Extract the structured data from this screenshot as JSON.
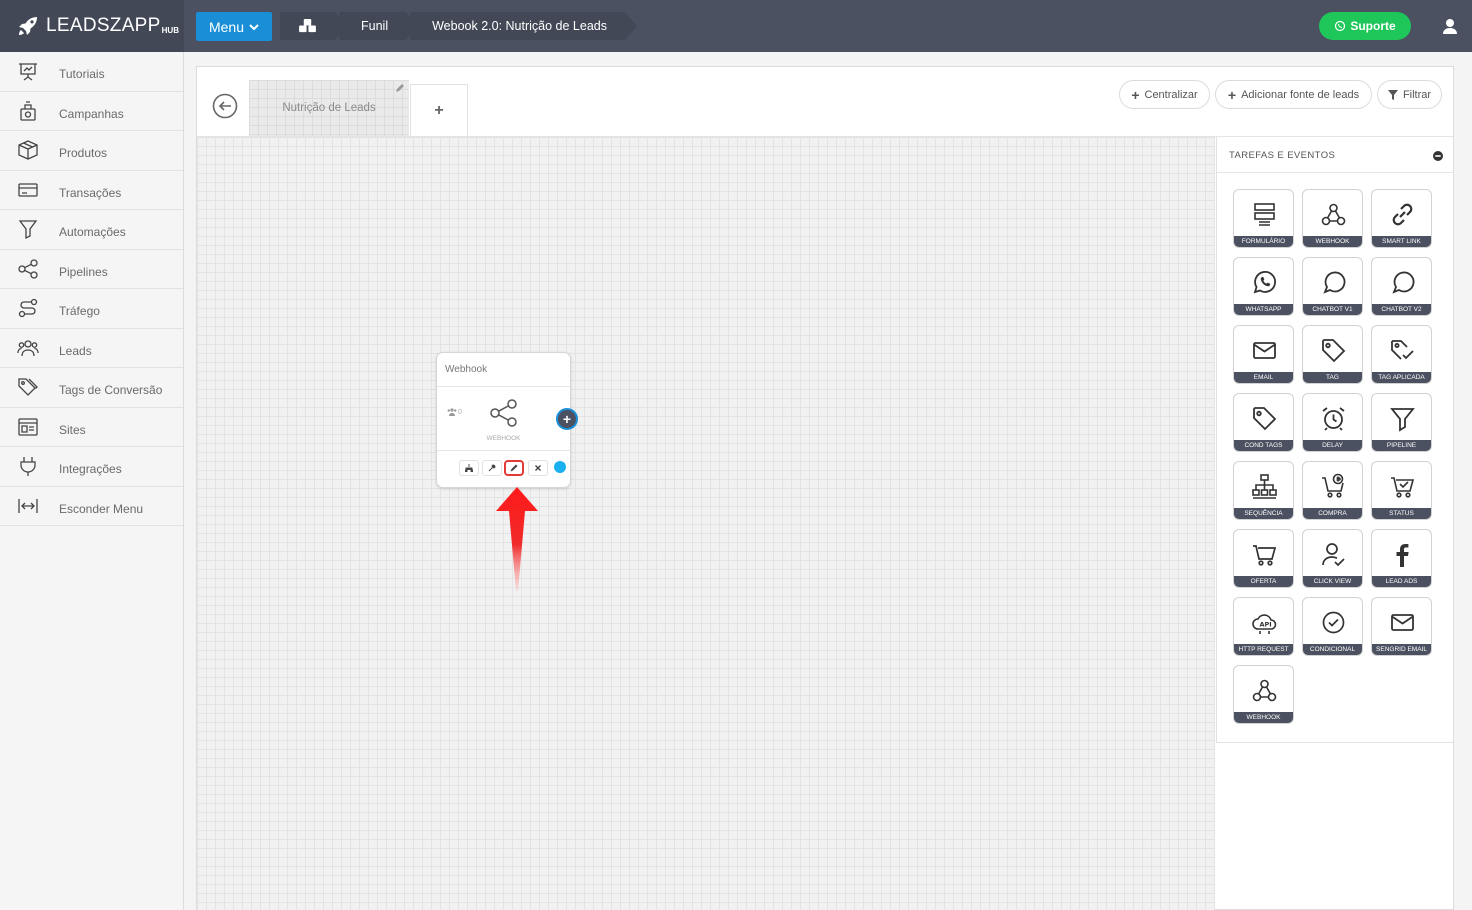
{
  "brand": {
    "name": "LEADSZAPP",
    "suffix": "HUB"
  },
  "header": {
    "menu_label": "Menu",
    "breadcrumbs": [
      "Funil",
      "Webook 2.0: Nutrição de Leads"
    ],
    "support_label": "Suporte",
    "colors": {
      "topbar": "#4b5160",
      "menu": "#1a8fd8",
      "support": "#1fc65a"
    }
  },
  "sidebar": {
    "items": [
      {
        "label": "Tutoriais",
        "icon": "presentation-icon"
      },
      {
        "label": "Campanhas",
        "icon": "campaign-icon"
      },
      {
        "label": "Produtos",
        "icon": "box-icon"
      },
      {
        "label": "Transações",
        "icon": "credit-card-icon"
      },
      {
        "label": "Automações",
        "icon": "funnel-icon"
      },
      {
        "label": "Pipelines",
        "icon": "share-icon"
      },
      {
        "label": "Tráfego",
        "icon": "route-icon"
      },
      {
        "label": "Leads",
        "icon": "users-icon"
      },
      {
        "label": "Tags de Conversão",
        "icon": "tags-icon"
      },
      {
        "label": "Sites",
        "icon": "website-icon"
      },
      {
        "label": "Integrações",
        "icon": "plug-icon"
      },
      {
        "label": "Esconder Menu",
        "icon": "collapse-arrows-icon"
      }
    ]
  },
  "funnel": {
    "active_tab": "Nutrição de Leads",
    "add_tab": "+",
    "actions": {
      "center": "Centralizar",
      "add_source": "Adicionar fonte de leads",
      "filter": "Filtrar"
    }
  },
  "node": {
    "title": "Webhook",
    "count": "0",
    "type_label": "WEBHOOK",
    "plus": "+",
    "status_color": "#1ab0f0"
  },
  "tasks": {
    "title": "TAREFAS E EVENTOS",
    "items": [
      {
        "label": "FORMULÁRIO",
        "icon": "form-icon"
      },
      {
        "label": "WEBHOOK",
        "icon": "webhook-icon"
      },
      {
        "label": "SMART LINK",
        "icon": "link-icon"
      },
      {
        "label": "WHATSAPP",
        "icon": "whatsapp-icon"
      },
      {
        "label": "CHATBOT V1",
        "icon": "chat-bubble-icon"
      },
      {
        "label": "CHATBOT V2",
        "icon": "chat-bubble-icon"
      },
      {
        "label": "EMAIL",
        "icon": "envelope-icon"
      },
      {
        "label": "TAG",
        "icon": "tag-icon"
      },
      {
        "label": "TAG APLICADA",
        "icon": "tag-check-icon"
      },
      {
        "label": "COND TAGS",
        "icon": "tag-icon"
      },
      {
        "label": "DELAY",
        "icon": "alarm-clock-icon"
      },
      {
        "label": "PIPELINE",
        "icon": "funnel-icon"
      },
      {
        "label": "SEQUÊNCIA",
        "icon": "sitemap-icon"
      },
      {
        "label": "COMPRA",
        "icon": "cart-dollar-icon"
      },
      {
        "label": "STATUS",
        "icon": "cart-check-icon"
      },
      {
        "label": "OFERTA",
        "icon": "cart-icon"
      },
      {
        "label": "CLICK VIEW",
        "icon": "user-check-icon"
      },
      {
        "label": "LEAD ADS",
        "icon": "facebook-icon"
      },
      {
        "label": "HTTP REQUEST",
        "icon": "api-cloud-icon"
      },
      {
        "label": "CONDICIONAL",
        "icon": "check-circle-icon"
      },
      {
        "label": "SENGRID EMAIL",
        "icon": "envelope-icon"
      },
      {
        "label": "WEBHOOK",
        "icon": "webhook-icon"
      }
    ]
  }
}
